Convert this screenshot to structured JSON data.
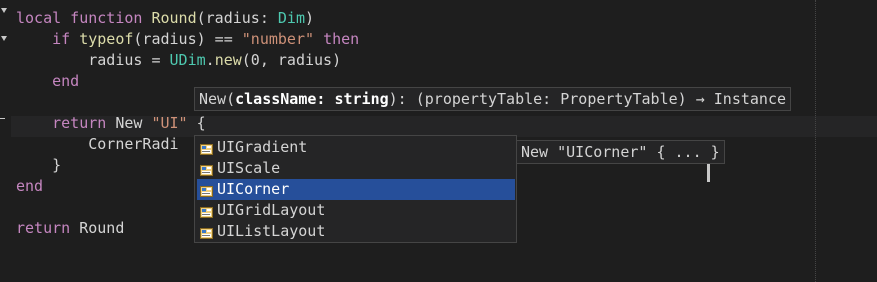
{
  "editor": {
    "lines": [
      [
        {
          "t": "local function ",
          "c": "kw"
        },
        {
          "t": "Round",
          "c": "fn"
        },
        {
          "t": "(radius: ",
          "c": "plain"
        },
        {
          "t": "Dim",
          "c": "type"
        },
        {
          "t": ")",
          "c": "plain"
        }
      ],
      [
        {
          "t": "    if ",
          "c": "kw"
        },
        {
          "t": "typeof",
          "c": "fn"
        },
        {
          "t": "(radius) == ",
          "c": "plain"
        },
        {
          "t": "\"number\"",
          "c": "str"
        },
        {
          "t": " ",
          "c": "plain"
        },
        {
          "t": "then",
          "c": "kw"
        }
      ],
      [
        {
          "t": "        radius = ",
          "c": "plain"
        },
        {
          "t": "UDim",
          "c": "type"
        },
        {
          "t": ".",
          "c": "plain"
        },
        {
          "t": "new",
          "c": "fn"
        },
        {
          "t": "(0, radius)",
          "c": "plain"
        }
      ],
      [
        {
          "t": "    end",
          "c": "kw"
        }
      ],
      [],
      [
        {
          "t": "    return ",
          "c": "kw"
        },
        {
          "t": "New ",
          "c": "plain"
        },
        {
          "t": "\"UI\"",
          "c": "str"
        },
        {
          "t": " {",
          "c": "plain"
        }
      ],
      [
        {
          "t": "        CornerRadi",
          "c": "plain"
        }
      ],
      [
        {
          "t": "    }",
          "c": "plain"
        }
      ],
      [
        {
          "t": "end",
          "c": "kw"
        }
      ],
      [],
      [
        {
          "t": "return ",
          "c": "kw"
        },
        {
          "t": "Round",
          "c": "plain"
        }
      ]
    ]
  },
  "signature_help": {
    "prefix": "New(",
    "param": "className: string",
    "suffix": "): (propertyTable: PropertyTable) → Instance"
  },
  "suggestions": {
    "items": [
      "UIGradient",
      "UIScale",
      "UICorner",
      "UIGridLayout",
      "UIListLayout"
    ],
    "selected_index": 2
  },
  "detail": {
    "text": "New \"UICorner\" { ... }"
  },
  "colors": {
    "keyword": "#c586c0",
    "function": "#dcdcaa",
    "type": "#4ec9b0",
    "string": "#ce9178",
    "selection": "#264f9a"
  }
}
